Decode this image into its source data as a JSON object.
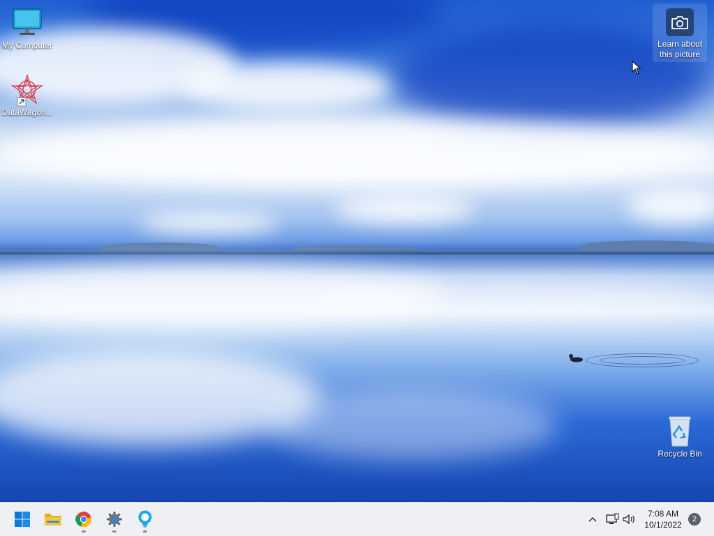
{
  "desktop": {
    "icons": [
      {
        "label": "My Computer",
        "icon": "monitor-icon"
      },
      {
        "label": "DataWagon...",
        "icon": "datawagon-app-icon"
      },
      {
        "label": "Recycle Bin",
        "icon": "recycle-bin-icon"
      }
    ],
    "spotlight": {
      "label_line1": "Learn about",
      "label_line2": "this picture",
      "icon": "camera-icon"
    }
  },
  "taskbar": {
    "apps": [
      {
        "name": "Start",
        "icon": "windows-start-icon"
      },
      {
        "name": "File Explorer",
        "icon": "folder-icon"
      },
      {
        "name": "Google Chrome",
        "icon": "chrome-icon"
      },
      {
        "name": "Settings",
        "icon": "gear-icon"
      },
      {
        "name": "Bulb app",
        "icon": "lightbulb-icon"
      }
    ],
    "tray": {
      "chevron": "chevron-up-icon",
      "network": "network-icon",
      "volume": "speaker-icon"
    },
    "clock": {
      "time": "7:08 AM",
      "date": "10/1/2022"
    },
    "notification_count": "2"
  },
  "colors": {
    "accent": "#0067c0",
    "taskbar_bg": "#eef0f4"
  }
}
